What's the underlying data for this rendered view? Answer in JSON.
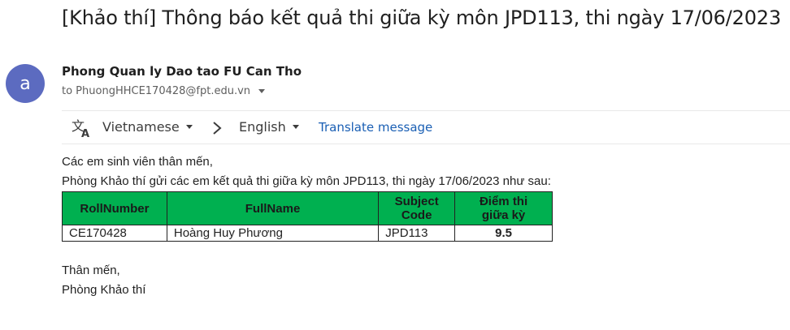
{
  "email": {
    "subject": "[Khảo thí] Thông báo kết quả thi giữa kỳ môn JPD113, thi ngày 17/06/2023",
    "avatar_letter": "a",
    "avatar_color": "#5c6bc0",
    "sender_name": "Phong Quan ly Dao tao FU Can Tho",
    "to_line": "to PhuongHHCE170428@fpt.edu.vn"
  },
  "translate": {
    "icon": "translate-icon",
    "from_lang": "Vietnamese",
    "to_lang": "English",
    "link": "Translate message"
  },
  "body": {
    "greeting": "Các em sinh viên thân mến,",
    "intro": "Phòng Khảo thí gửi các em kết quả thi giữa kỳ môn JPD113, thi ngày 17/06/2023 như sau:",
    "closing_1": "Thân mến,",
    "closing_2": "Phòng Khảo thí"
  },
  "table": {
    "header_color": "#00b050",
    "headers": [
      "RollNumber",
      "FullName",
      "Subject Code",
      "Điểm thi giữa kỳ"
    ],
    "rows": [
      [
        "CE170428",
        "Hoàng Huy Phương",
        "JPD113",
        "9.5"
      ]
    ]
  }
}
